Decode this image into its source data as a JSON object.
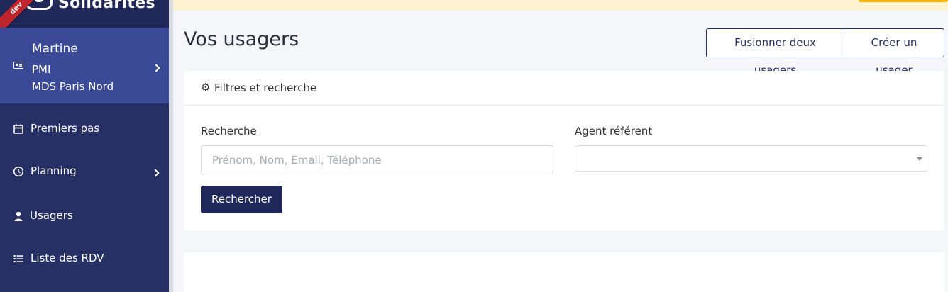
{
  "brand": {
    "name": "Solidarités",
    "ribbon": "dev"
  },
  "user": {
    "name": "Martine",
    "service": "PMI",
    "organisation": "MDS Paris Nord"
  },
  "nav": {
    "items": [
      {
        "label": "Premiers pas",
        "icon": "calendar-icon"
      },
      {
        "label": "Planning",
        "icon": "clock-icon"
      },
      {
        "label": "Usagers",
        "icon": "user-icon"
      },
      {
        "label": "Liste des RDV",
        "icon": "list-icon"
      }
    ]
  },
  "main": {
    "title": "Vos usagers",
    "actions": {
      "merge_label": "Fusionner deux usagers",
      "create_label": "Créer un usager"
    },
    "filters": {
      "header_icon": "⚙",
      "header": "Filtres et recherche",
      "search_label": "Recherche",
      "search_placeholder": "Prénom, Nom, Email, Téléphone",
      "search_value": "",
      "agent_label": "Agent référent",
      "agent_value": "",
      "submit_label": "Rechercher"
    }
  },
  "colors": {
    "sidebar": "#263065",
    "sidebar_active": "#3a4a96",
    "primary": "#1f2858",
    "banner": "#fdf3d3",
    "ribbon": "#c0242c"
  }
}
